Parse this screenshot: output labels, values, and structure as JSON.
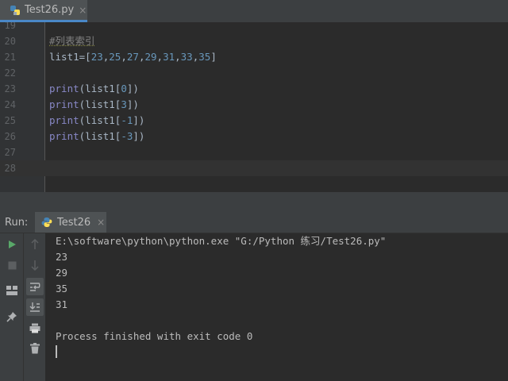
{
  "editor_tab": {
    "label": "Test26.py",
    "close": "×"
  },
  "editor": {
    "lines": [
      {
        "num": "19"
      },
      {
        "num": "20",
        "comment": "#列表索引"
      },
      {
        "num": "21",
        "prefix": "list1=[",
        "nums": [
          "23",
          "25",
          "27",
          "29",
          "31",
          "33",
          "35"
        ],
        "suffix": "]"
      },
      {
        "num": "22"
      },
      {
        "num": "23",
        "fn": "print",
        "open": "(list1[",
        "arg": "0",
        "close": "])"
      },
      {
        "num": "24",
        "fn": "print",
        "open": "(list1[",
        "arg": "3",
        "close": "])"
      },
      {
        "num": "25",
        "fn": "print",
        "open": "(list1[",
        "arg": "-1",
        "close": "])"
      },
      {
        "num": "26",
        "fn": "print",
        "open": "(list1[",
        "arg": "-3",
        "close": "])"
      },
      {
        "num": "27"
      },
      {
        "num": "28"
      }
    ]
  },
  "run_panel": {
    "label": "Run:",
    "tab": {
      "label": "Test26",
      "close": "×"
    }
  },
  "console": {
    "command": "E:\\software\\python\\python.exe \"G:/Python 练习/Test26.py\"",
    "outputs": [
      "23",
      "29",
      "35",
      "31"
    ],
    "finish": "Process finished with exit code 0"
  },
  "colors": {
    "accent": "#4a88c7",
    "run_green": "#59a869",
    "comment": "#808080",
    "number": "#6897bb",
    "builtin": "#8888c6"
  }
}
